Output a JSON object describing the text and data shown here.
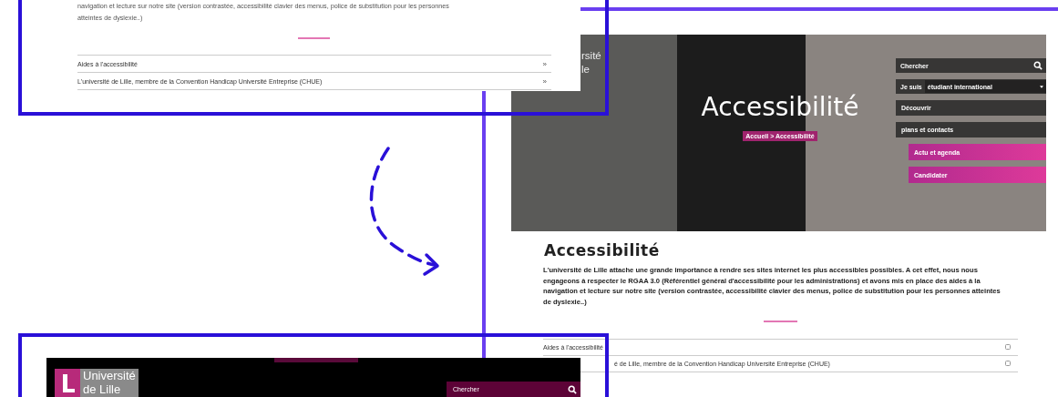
{
  "top_left_snapshot": {
    "paragraph_lines": [
      "navigation et lecture sur notre site (version contrastée, accessibilité clavier des menus, police de substitution pour les personnes",
      "atteintes de dyslexie..)"
    ],
    "links": [
      {
        "label": "Aides à l'accessibilité",
        "chevron": "»"
      },
      {
        "label": "L'université de Lille, membre de la Convention Handicap Université Entreprise (CHUE)",
        "chevron": "»"
      }
    ]
  },
  "right_snapshot": {
    "hero": {
      "logo_fragments": [
        "rsité",
        "le"
      ],
      "title": "Accessibilité",
      "breadcrumb": "Accueil > Accessibilité",
      "search": {
        "placeholder": "Chercher"
      },
      "profile": {
        "label": "Je suis",
        "value": "étudiant international"
      },
      "menu": [
        {
          "label": "Découvrir",
          "kind": "dark"
        },
        {
          "label": "plans et contacts",
          "kind": "dark"
        },
        {
          "label": "Actu et agenda",
          "kind": "accent"
        },
        {
          "label": "Candidater",
          "kind": "accent"
        }
      ]
    },
    "content": {
      "title": "Accessibilité",
      "paragraph": "L'université de Lille attache une grande importance à rendre  ses sites internet les plus accessibles possibles. A cet effet, nous nous engageons à respecter le RGAA 3.0 (Référentiel général d'accessibilité pour les administrations) et avons mis en place des aides à la navigation et lecture sur notre site (version contrastée, accessibilité clavier des menus, police de substitution pour les personnes atteintes de dyslexie..)",
      "links": [
        {
          "label": "Aides à l'accessibilité"
        },
        {
          "label": "é de Lille, membre de la Convention Handicap Université Entreprise (CHUE)"
        }
      ]
    }
  },
  "bottom_left_snapshot": {
    "logo": {
      "line_1": "Université",
      "line_2": "de Lille"
    },
    "search": {
      "placeholder": "Chercher"
    }
  }
}
